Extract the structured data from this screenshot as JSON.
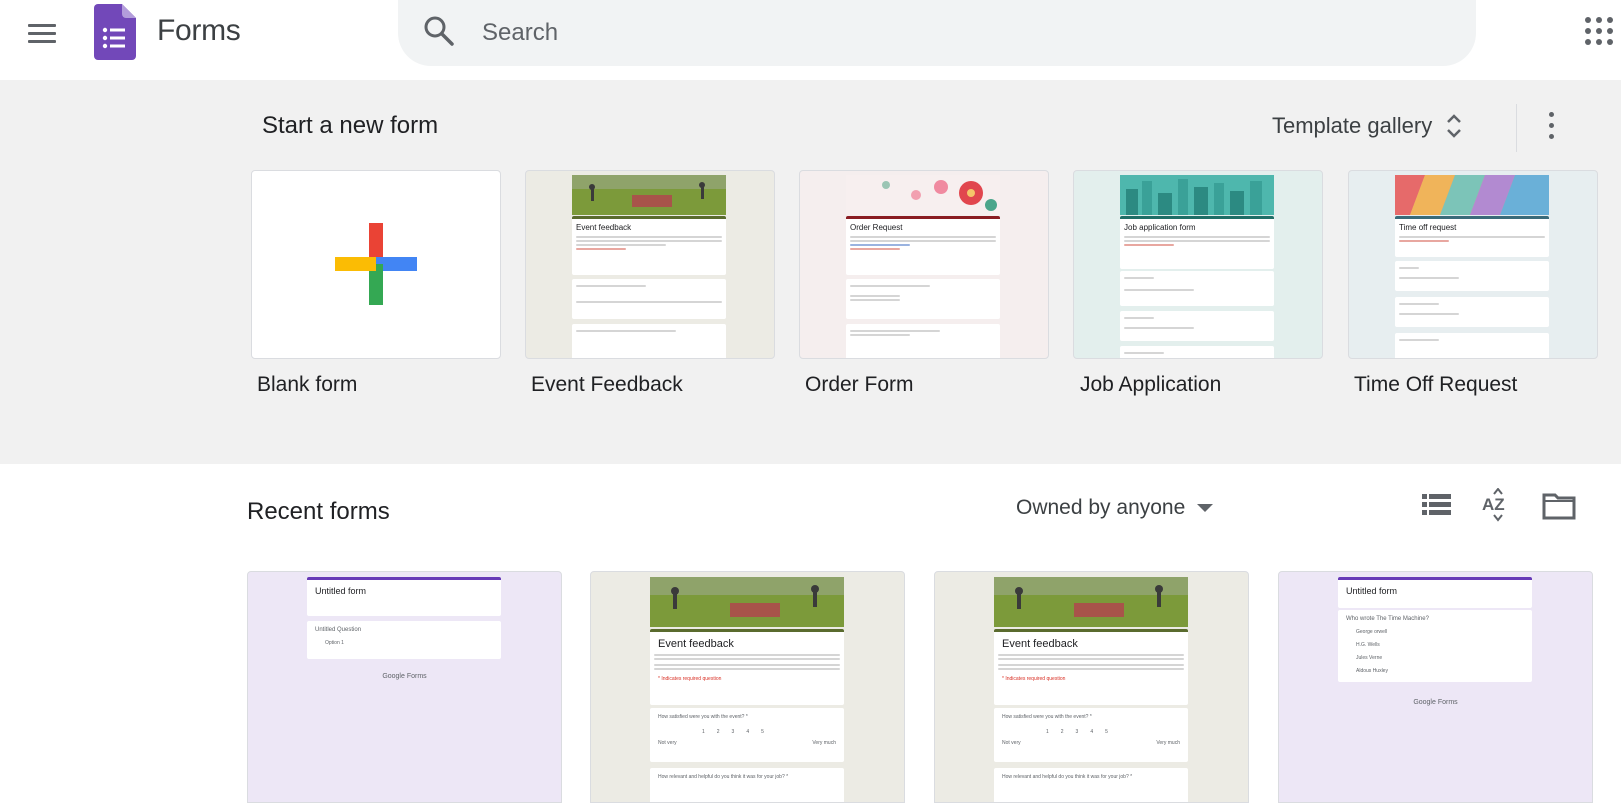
{
  "header": {
    "app_title": "Forms",
    "search_placeholder": "Search"
  },
  "start": {
    "title": "Start a new form",
    "gallery_label": "Template gallery",
    "templates": [
      {
        "label": "Blank form"
      },
      {
        "label": "Event Feedback",
        "preview_title": "Event feedback"
      },
      {
        "label": "Order Form",
        "preview_title": "Order Request"
      },
      {
        "label": "Job Application",
        "preview_title": "Job application form"
      },
      {
        "label": "Time Off Request",
        "preview_title": "Time off request"
      }
    ]
  },
  "recent": {
    "title": "Recent forms",
    "owner_filter": "Owned by anyone",
    "forms": [
      {
        "preview_title": "Untitled form",
        "question": "Untitled Question",
        "option": "Option 1",
        "branding": "Google Forms"
      },
      {
        "preview_title": "Event feedback",
        "q1": "How satisfied were you with the event? *",
        "q2": "How relevant and helpful do you think it was for your job? *",
        "low": "Not very",
        "high": "Very much",
        "required": "* Indicates required question"
      },
      {
        "preview_title": "Event feedback",
        "q1": "How satisfied were you with the event? *",
        "q2": "How relevant and helpful do you think it was for your job? *",
        "low": "Not very",
        "high": "Very much",
        "required": "* Indicates required question"
      },
      {
        "preview_title": "Untitled form",
        "question": "Who wrote The Time Machine?",
        "options": [
          "George orwell",
          "H.G. Wells",
          "Jules Verne",
          "Aldous Huxley"
        ],
        "branding": "Google Forms"
      }
    ]
  },
  "colors": {
    "forms_purple": "#7248b9",
    "plus_red": "#ea4335",
    "plus_blue": "#4285f4",
    "plus_yellow": "#fbbc04",
    "plus_green": "#34a853"
  }
}
